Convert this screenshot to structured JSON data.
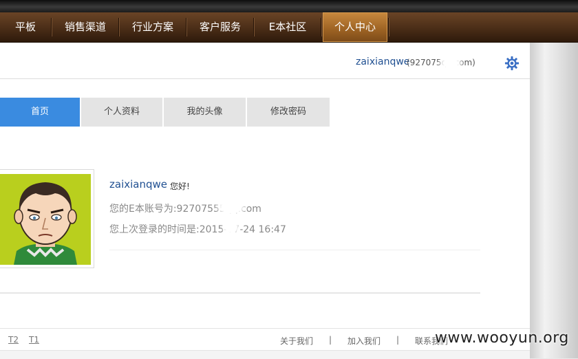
{
  "nav": {
    "items": [
      {
        "label": "平板"
      },
      {
        "label": "销售渠道"
      },
      {
        "label": "行业方案"
      },
      {
        "label": "客户服务"
      },
      {
        "label": "E本社区"
      },
      {
        "label": "个人中心"
      }
    ],
    "active": "个人中心"
  },
  "user": {
    "name": "zaixianqwe",
    "email": "(927075qq.com)"
  },
  "tabs": [
    {
      "label": "首页"
    },
    {
      "label": "个人资料"
    },
    {
      "label": "我的头像"
    },
    {
      "label": "修改密码"
    }
  ],
  "profile": {
    "name": "zaixianqwe",
    "greeting": "您好!",
    "account_line": "您的E本账号为:92707555qq.com",
    "last_login_line": "您上次登录的时间是:2015-07-24 16:47"
  },
  "footer": {
    "left_links": [
      "T2",
      "T1"
    ],
    "right_links": [
      "关于我们",
      "加入我们",
      "联系我们"
    ],
    "separator": "|"
  },
  "watermark": "www.wooyun.org",
  "colors": {
    "nav_bg": "#4a2d17",
    "nav_active": "#b07230",
    "tab_active": "#3a8be0",
    "link_blue": "#1f4f91"
  }
}
